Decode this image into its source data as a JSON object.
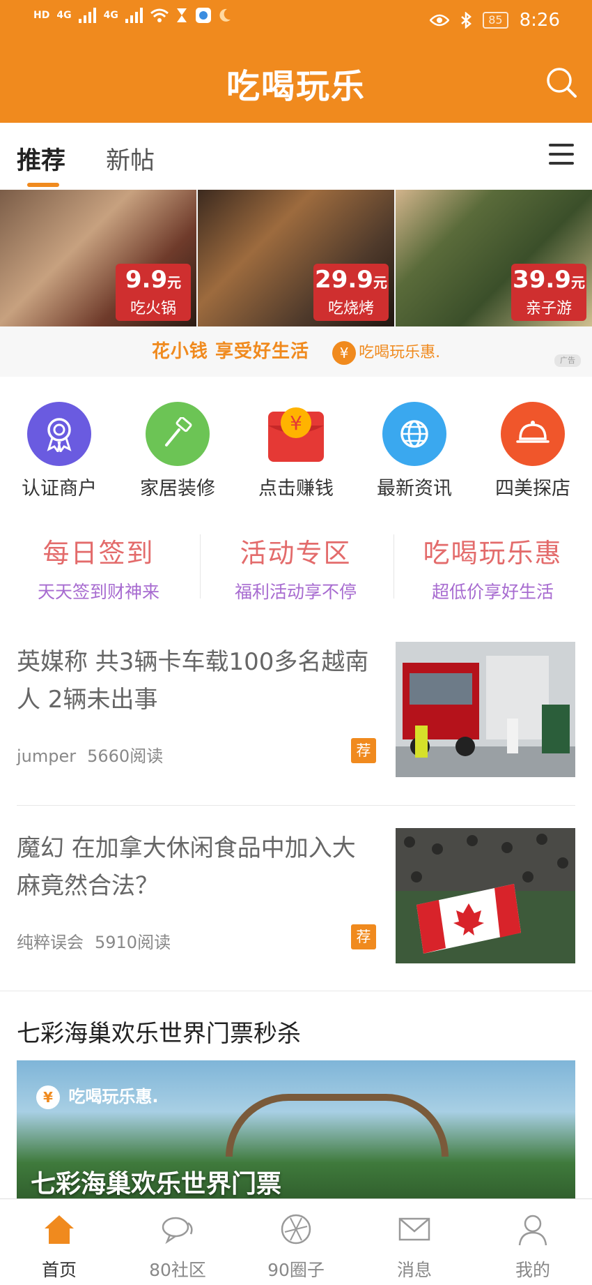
{
  "status_bar": {
    "left_labels": [
      "HD",
      "HD",
      "4G",
      "4G"
    ],
    "battery": "85",
    "time": "8:26"
  },
  "header": {
    "title": "吃喝玩乐",
    "accent": "#f08a1e"
  },
  "tabs": {
    "recommend": "推荐",
    "new_posts": "新帖"
  },
  "banner": {
    "deals": [
      {
        "price": "9.9",
        "unit": "元",
        "name": "吃火锅"
      },
      {
        "price": "29.9",
        "unit": "元",
        "name": "吃烧烤"
      },
      {
        "price": "39.9",
        "unit": "元",
        "name": "亲子游"
      }
    ],
    "slogan": "花小钱  享受好生活",
    "brand": "吃喝玩乐惠.",
    "coin_glyph": "¥",
    "ad_tag": "广告"
  },
  "grid": [
    {
      "label": "认证商户",
      "icon": "ribbon-icon",
      "color": "#6a5be0"
    },
    {
      "label": "家居装修",
      "icon": "roller-icon",
      "color": "#6cc455"
    },
    {
      "label": "点击赚钱",
      "icon": "red-envelope-icon",
      "color": "#e53935"
    },
    {
      "label": "最新资讯",
      "icon": "globe-icon",
      "color": "#3aa8ef"
    },
    {
      "label": "四美探店",
      "icon": "cloche-icon",
      "color": "#f0562b"
    }
  ],
  "promos": [
    {
      "title": "每日签到",
      "subtitle": "天天签到财神来"
    },
    {
      "title": "活动专区",
      "subtitle": "福利活动享不停"
    },
    {
      "title": "吃喝玩乐惠",
      "subtitle": "超低价享好生活"
    }
  ],
  "articles": [
    {
      "title": "英媒称 共3辆卡车载100多名越南人 2辆未出事",
      "author": "jumper",
      "reads": "5660阅读",
      "tag": "荐"
    },
    {
      "title": "魔幻 在加拿大休闲食品中加入大麻竟然合法？",
      "author": "纯粹误会",
      "reads": "5910阅读",
      "tag": "荐"
    }
  ],
  "feature": {
    "title": "七彩海巢欢乐世界门票秒杀",
    "brand": "吃喝玩乐惠.",
    "overlay": "七彩海巢欢乐世界门票"
  },
  "bottom_nav": [
    {
      "label": "首页",
      "icon": "home-icon",
      "active": true
    },
    {
      "label": "80社区",
      "icon": "chat-icon",
      "active": false
    },
    {
      "label": "90圈子",
      "icon": "aperture-icon",
      "active": false
    },
    {
      "label": "消息",
      "icon": "mail-icon",
      "active": false
    },
    {
      "label": "我的",
      "icon": "user-icon",
      "active": false
    }
  ]
}
